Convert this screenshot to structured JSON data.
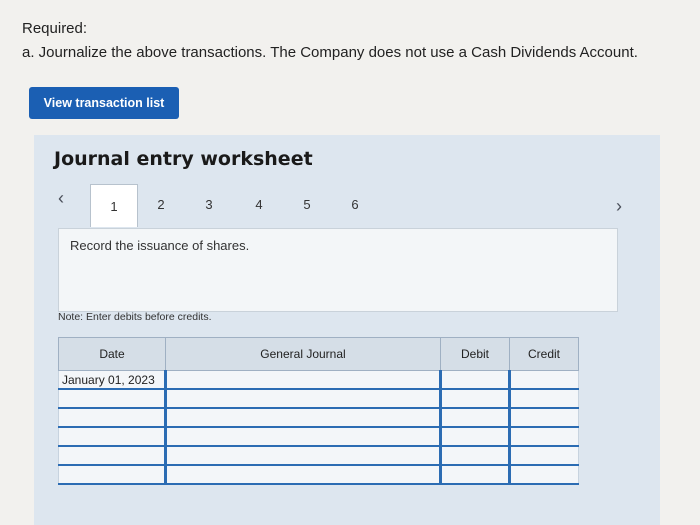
{
  "header": {
    "required_label": "Required:",
    "instruction": "a. Journalize the above transactions. The Company does not use a Cash Dividends Account."
  },
  "buttons": {
    "view_transaction_list": "View transaction list"
  },
  "worksheet": {
    "title": "Journal entry worksheet",
    "tabs": [
      "1",
      "2",
      "3",
      "4",
      "5",
      "6"
    ],
    "active_tab": "1",
    "record_text": "Record the issuance of shares.",
    "note": "Note: Enter debits before credits."
  },
  "journal": {
    "columns": [
      "Date",
      "General Journal",
      "Debit",
      "Credit"
    ],
    "rows": [
      {
        "date": "January 01, 2023",
        "account": "",
        "debit": "",
        "credit": ""
      },
      {
        "date": "",
        "account": "",
        "debit": "",
        "credit": ""
      },
      {
        "date": "",
        "account": "",
        "debit": "",
        "credit": ""
      },
      {
        "date": "",
        "account": "",
        "debit": "",
        "credit": ""
      },
      {
        "date": "",
        "account": "",
        "debit": "",
        "credit": ""
      },
      {
        "date": "",
        "account": "",
        "debit": "",
        "credit": ""
      }
    ]
  }
}
